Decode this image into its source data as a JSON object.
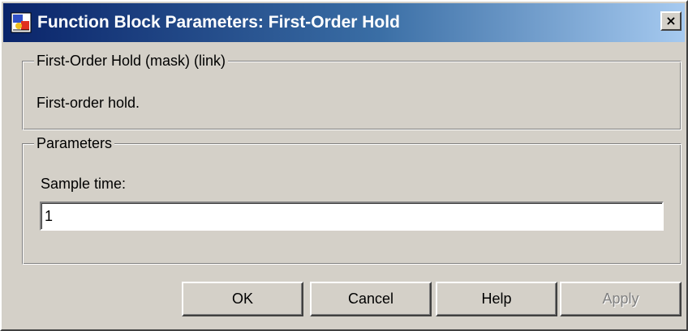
{
  "window": {
    "title": "Function Block Parameters: First-Order Hold",
    "icon": "simulink-block-icon",
    "close_label": "×"
  },
  "description_group": {
    "legend": "First-Order Hold (mask) (link)",
    "text": "First-order hold."
  },
  "parameters_group": {
    "legend": "Parameters",
    "sample_time_label": "Sample time:",
    "sample_time_value": "1"
  },
  "buttons": {
    "ok": "OK",
    "cancel": "Cancel",
    "help": "Help",
    "apply": "Apply",
    "apply_enabled": false
  },
  "colors": {
    "titlebar_start": "#0a246a",
    "titlebar_end": "#a6caf0",
    "face": "#d4d0c8",
    "disabled_text": "#808080"
  }
}
